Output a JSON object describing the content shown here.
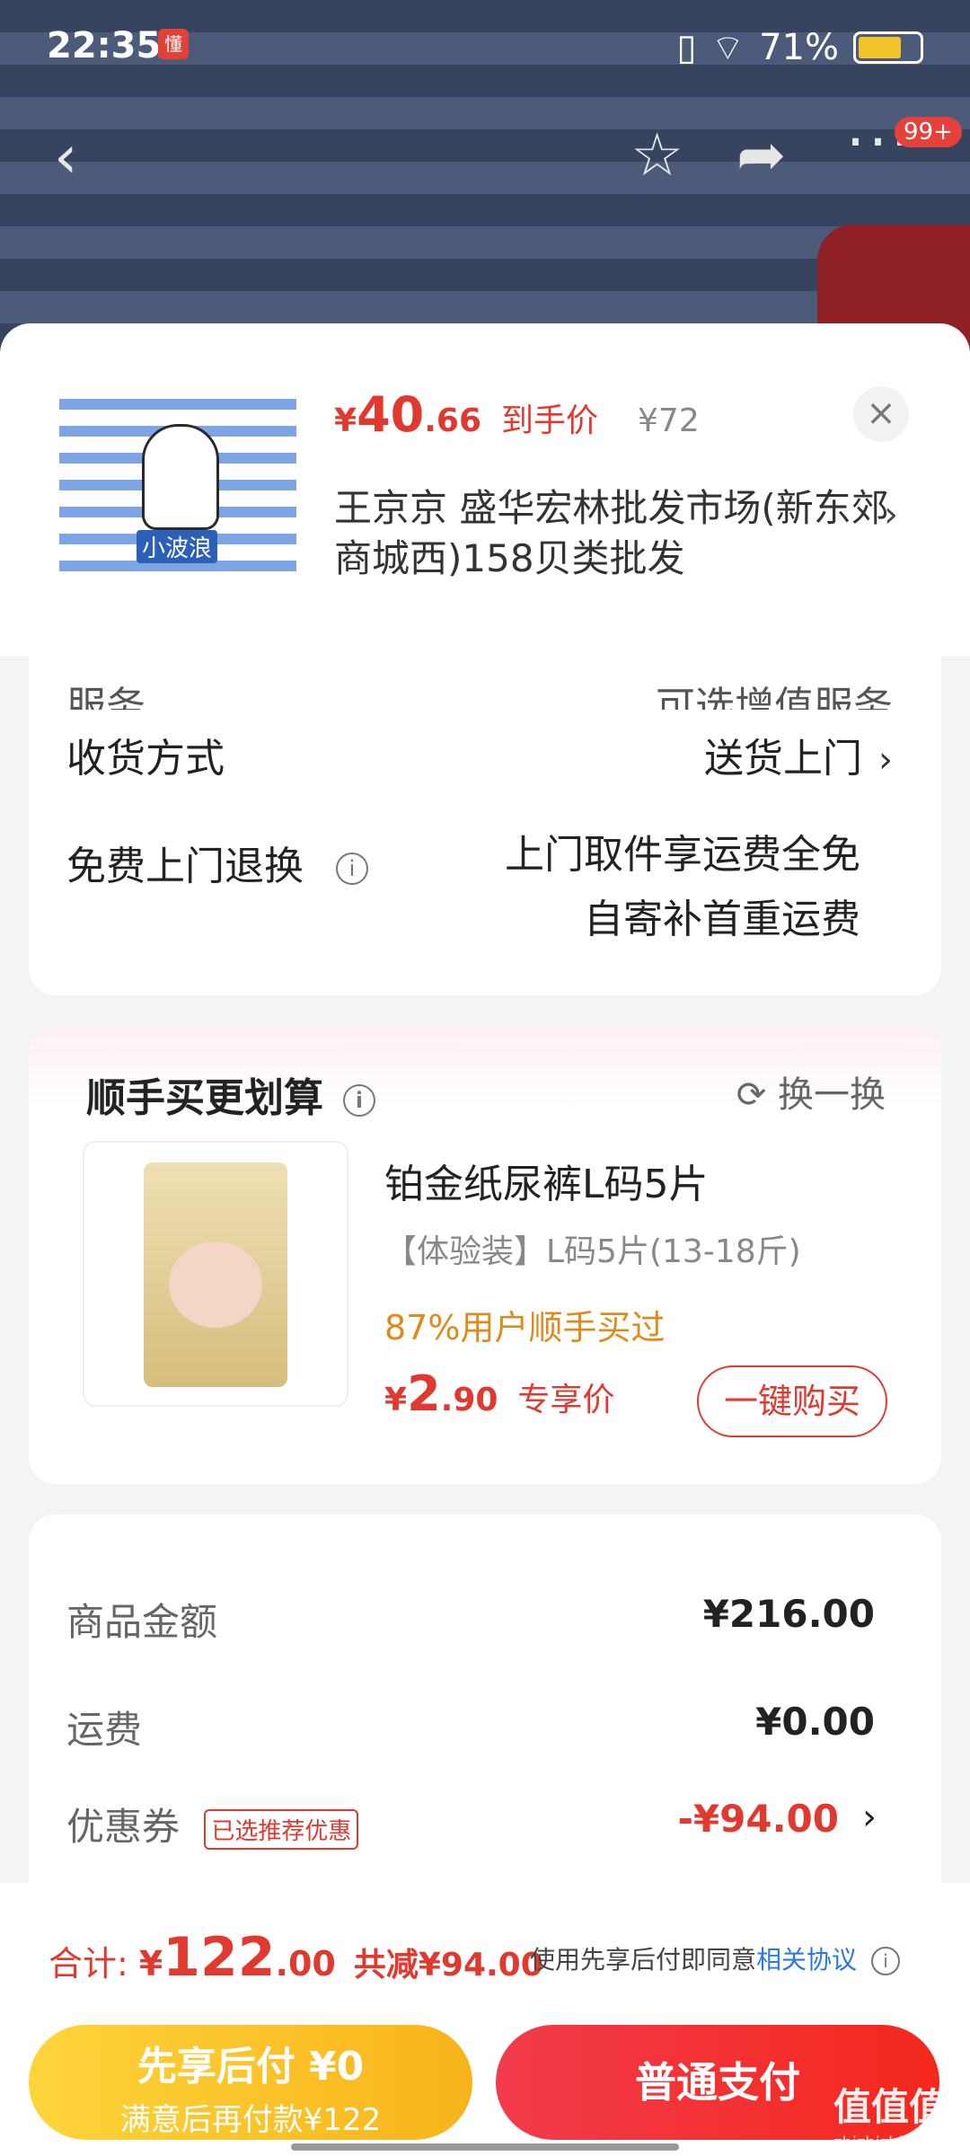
{
  "status_bar": {
    "time": "22:35",
    "app_icon": "懂",
    "battery": "71%",
    "battery_level": 0.71
  },
  "nav": {
    "badge": "99+",
    "icons": [
      "back-icon",
      "star-icon",
      "share-icon",
      "more-icon"
    ]
  },
  "product": {
    "price_yen": "¥",
    "price_int": "40",
    "price_dec": ".66",
    "price_tag": "到手价",
    "orig_price": "¥72",
    "store": "王京京  盛华宏林批发市场(新东郊商城西)158贝类批发",
    "thumb_label": "小波浪",
    "close": "×"
  },
  "options": {
    "cut_label": "服务",
    "cut_value": "可选增值服务",
    "delivery_label": "收货方式",
    "delivery_value": "送货上门",
    "return_label": "免费上门退换",
    "return_value_1": "上门取件享运费全免",
    "return_value_2": "自寄补首重运费"
  },
  "upsell": {
    "title": "顺手买更划算",
    "swap": "换一换",
    "name": "铂金纸尿裤L码5片",
    "sub": "【体验装】L码5片(13-18斤)",
    "percent": "87%用户顺手买过",
    "price_yen": "¥",
    "price_int": "2",
    "price_dec": ".90",
    "price_tag": "专享价",
    "buy": "一键购买"
  },
  "summary": {
    "goods_label": "商品金额",
    "goods_value": "¥216.00",
    "ship_label": "运费",
    "ship_value": "¥0.00",
    "coupon_label": "优惠券",
    "coupon_badge": "已选推荐优惠",
    "coupon_value": "-¥94.00"
  },
  "footer": {
    "total_label": "合计:",
    "total_yen": "¥",
    "total_int": "122",
    "total_dec": ".00",
    "saved": "共减¥94.00",
    "agree_text": "使用先享后付即同意",
    "agree_link": "相关协议",
    "later_a": "先享后付 ¥0",
    "later_b": "满意后再付款¥122",
    "pay": "普通支付"
  },
  "watermark": {
    "main": "值值值",
    "sub": "zhizhizhi.com"
  },
  "colors": {
    "accent": "#e03a30",
    "pay": "#f2293a",
    "later": "#f9c12c",
    "link": "#2b78e4"
  }
}
